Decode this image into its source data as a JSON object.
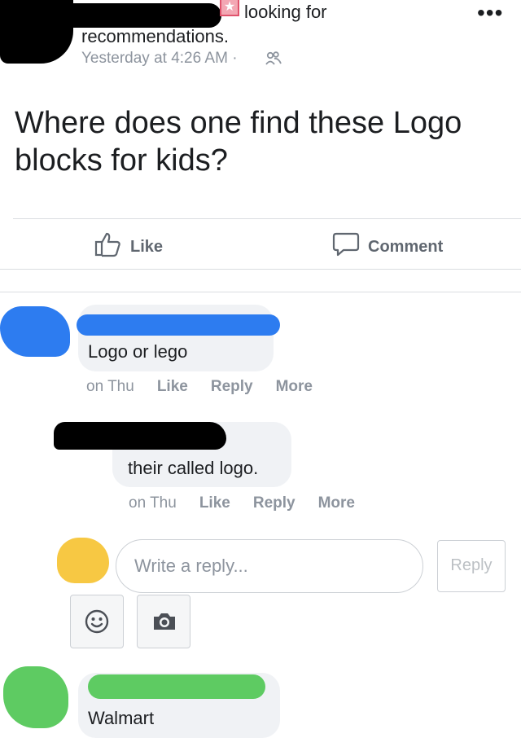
{
  "post": {
    "header_line1": "looking for",
    "header_line2": "recommendations.",
    "timestamp": "Yesterday at 4:26 AM ·",
    "audience_icon": "friends-icon",
    "menu_icon": "more-dots-icon",
    "body": "Where does one find these Logo blocks for kids?"
  },
  "actions": {
    "like_label": "Like",
    "comment_label": "Comment"
  },
  "comments": [
    {
      "text": "Logo or lego",
      "time": "on Thu",
      "like": "Like",
      "reply": "Reply",
      "more": "More",
      "redaction_color": "#2d7cf0"
    },
    {
      "text": "their called logo.",
      "time": "on Thu",
      "like": "Like",
      "reply": "Reply",
      "more": "More",
      "redaction_color": "#000000"
    },
    {
      "text": "Walmart",
      "redaction_color": "#5ecb62"
    }
  ],
  "reply_box": {
    "placeholder": "Write a reply...",
    "submit_label": "Reply",
    "avatar_color": "#f7c843",
    "emoji_icon": "emoji-icon",
    "camera_icon": "camera-icon"
  }
}
